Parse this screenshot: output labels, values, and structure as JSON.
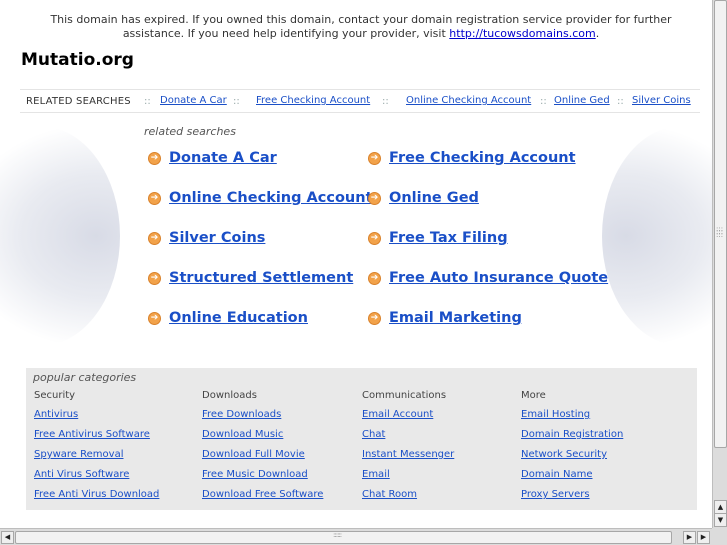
{
  "notice": {
    "text": "This domain has expired. If you owned this domain, contact your domain registration service provider for further assistance. If you need help identifying your provider, visit ",
    "link": "http://tucowsdomains.com",
    "end": "."
  },
  "site_title": "Mutatio.org",
  "related_bar": {
    "label": "RELATED SEARCHES",
    "separator": "::",
    "links": [
      "Donate A Car",
      "Free Checking Account",
      "Online Checking Account",
      "Online Ged",
      "Silver Coins"
    ]
  },
  "related_searches": {
    "caption": "related searches",
    "arrow_glyph": "➔",
    "items": [
      "Donate A Car",
      "Free Checking Account",
      "Online Checking Account",
      "Online Ged",
      "Silver Coins",
      "Free Tax Filing",
      "Structured Settlement",
      "Free Auto Insurance Quote",
      "Online Education",
      "Email Marketing"
    ]
  },
  "popular_categories": {
    "title": "popular categories",
    "columns": [
      {
        "heading": "Security",
        "links": [
          "Antivirus",
          "Free Antivirus Software",
          "Spyware Removal",
          "Anti Virus Software",
          "Free Anti Virus Download"
        ]
      },
      {
        "heading": "Downloads",
        "links": [
          "Free Downloads",
          "Download Music",
          "Download Full Movie",
          "Free Music Download",
          "Download Free Software"
        ]
      },
      {
        "heading": "Communications",
        "links": [
          "Email Account",
          "Chat",
          "Instant Messenger",
          "Email",
          "Chat Room"
        ]
      },
      {
        "heading": "More",
        "links": [
          "Email Hosting",
          "Domain Registration",
          "Network Security",
          "Domain Name",
          "Proxy Servers"
        ]
      }
    ]
  },
  "scrollbar": {
    "up": "▲",
    "down": "▼",
    "left": "◀",
    "right": "▶",
    "right2": "▶"
  },
  "colors": {
    "link": "#1a4fc7",
    "arrow": "#f2a24a",
    "panel_bg": "#e9e9e9"
  }
}
